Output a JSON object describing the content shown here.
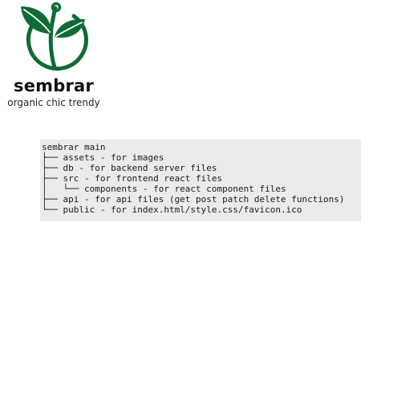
{
  "brand": {
    "name": "sembrar",
    "tagline": "organic chic trendy",
    "logo_icon": "sprout-leaf-circle-icon",
    "logo_color": "#0f6b35"
  },
  "code_block": {
    "background": "#ebebeb",
    "lines": [
      "sembrar main",
      "├── assets - for images",
      "├── db - for backend server files",
      "├── src - for frontend react files",
      "│   └── components - for react component files",
      "├── api - for api files (get post patch delete functions)",
      "└── public - for index.html/style.css/favicon.ico"
    ]
  }
}
